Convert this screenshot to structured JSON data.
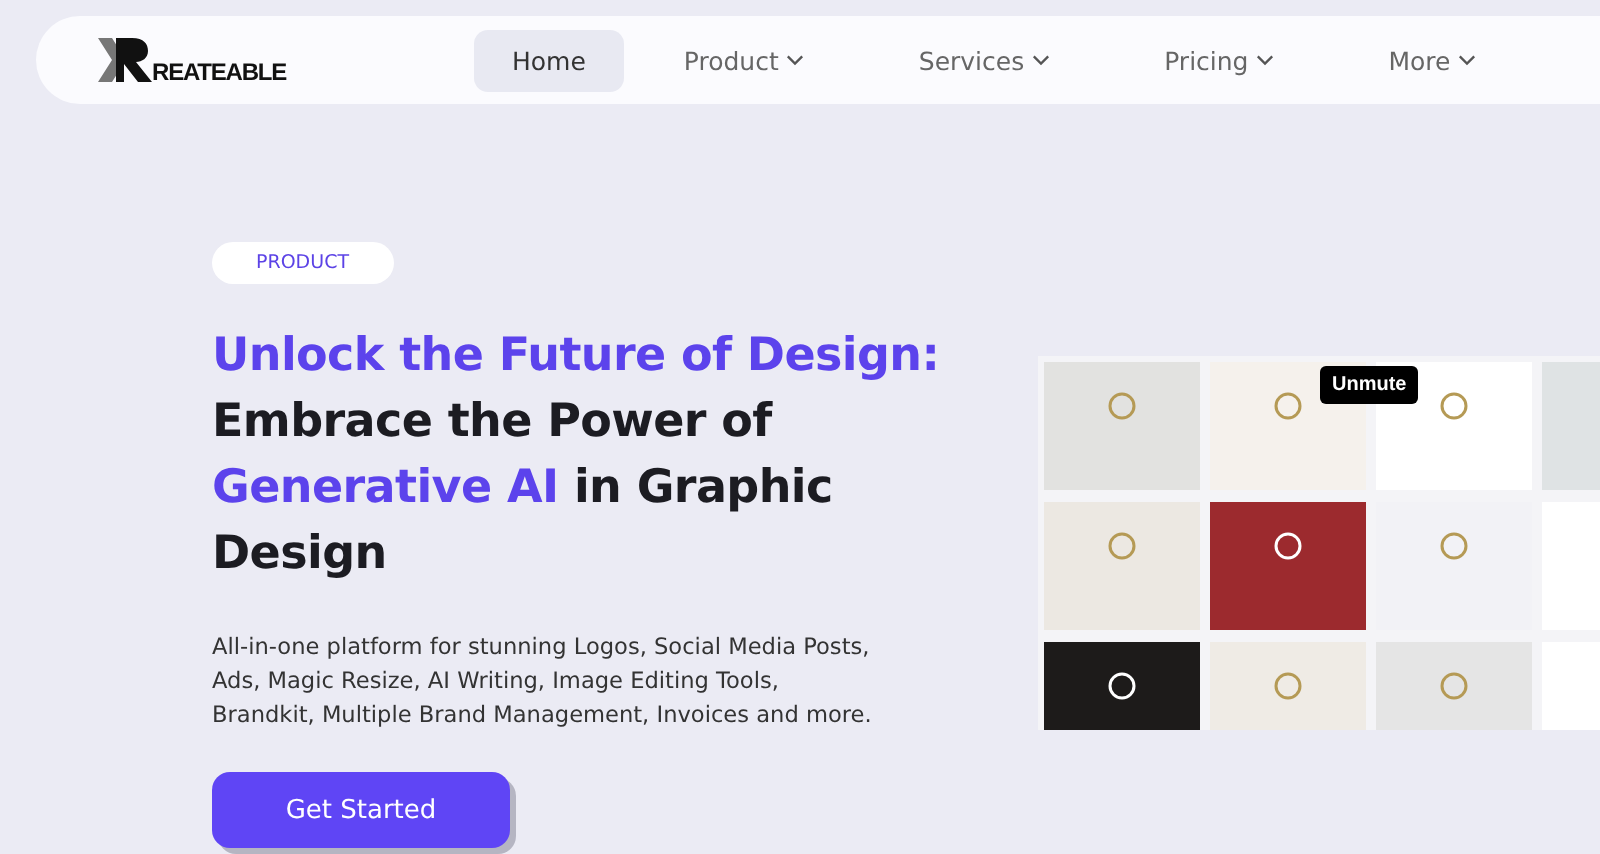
{
  "header": {
    "logo": "REATEABLE",
    "nav": [
      {
        "label": "Home",
        "selected": true,
        "dropdown": false
      },
      {
        "label": "Product",
        "selected": false,
        "dropdown": true
      },
      {
        "label": "Services",
        "selected": false,
        "dropdown": true
      },
      {
        "label": "Pricing",
        "selected": false,
        "dropdown": true
      },
      {
        "label": "More",
        "selected": false,
        "dropdown": true
      }
    ]
  },
  "hero": {
    "badge": "PRODUCT",
    "headline": [
      [
        {
          "text": "Unlock the Future of Design:",
          "accent": true
        }
      ],
      [
        {
          "text": "Embrace the Power of",
          "accent": false
        }
      ],
      [
        {
          "text": "Generative AI",
          "accent": true
        },
        {
          "text": " in Graphic",
          "accent": false
        }
      ],
      [
        {
          "text": "Design",
          "accent": false
        }
      ]
    ],
    "description": "All-in-one platform for stunning Logos, Social Media Posts, Ads, Magic Resize, AI Writing, Image Editing Tools, Brandkit, Multiple Brand Management, Invoices and more.",
    "cta": "Get Started"
  },
  "video": {
    "kind": "picture",
    "unmute": "Unmute"
  }
}
